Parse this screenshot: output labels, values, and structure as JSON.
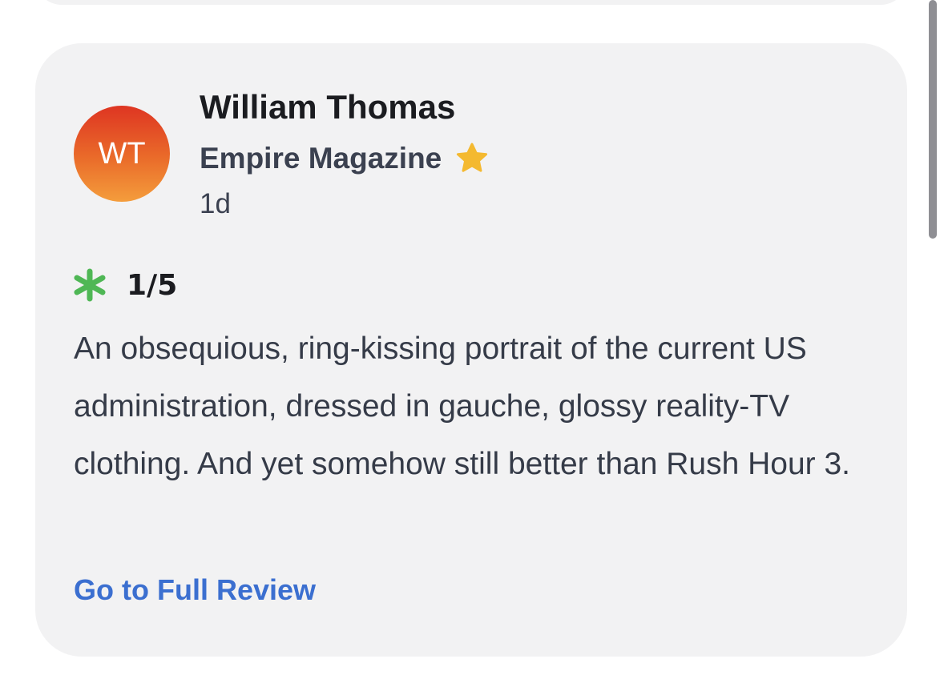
{
  "review": {
    "avatar_initials": "WT",
    "reviewer_name": "William Thomas",
    "publication": "Empire Magazine",
    "top_critic_icon": "star-icon",
    "timestamp": "1d",
    "rating_icon": "rotten-splat-icon",
    "score": "1/5",
    "text": "An obsequious, ring-kissing portrait of the current US administration, dressed in gauche, glossy reality-TV clothing. And yet somehow still better than Rush Hour 3.",
    "full_review_link": "Go to Full Review"
  },
  "colors": {
    "card_background": "#f2f2f3",
    "avatar_gradient_top": "#de3522",
    "avatar_gradient_bottom": "#f49d3c",
    "star": "#f4b930",
    "splat": "#4fb755",
    "link": "#3b6fd0"
  }
}
